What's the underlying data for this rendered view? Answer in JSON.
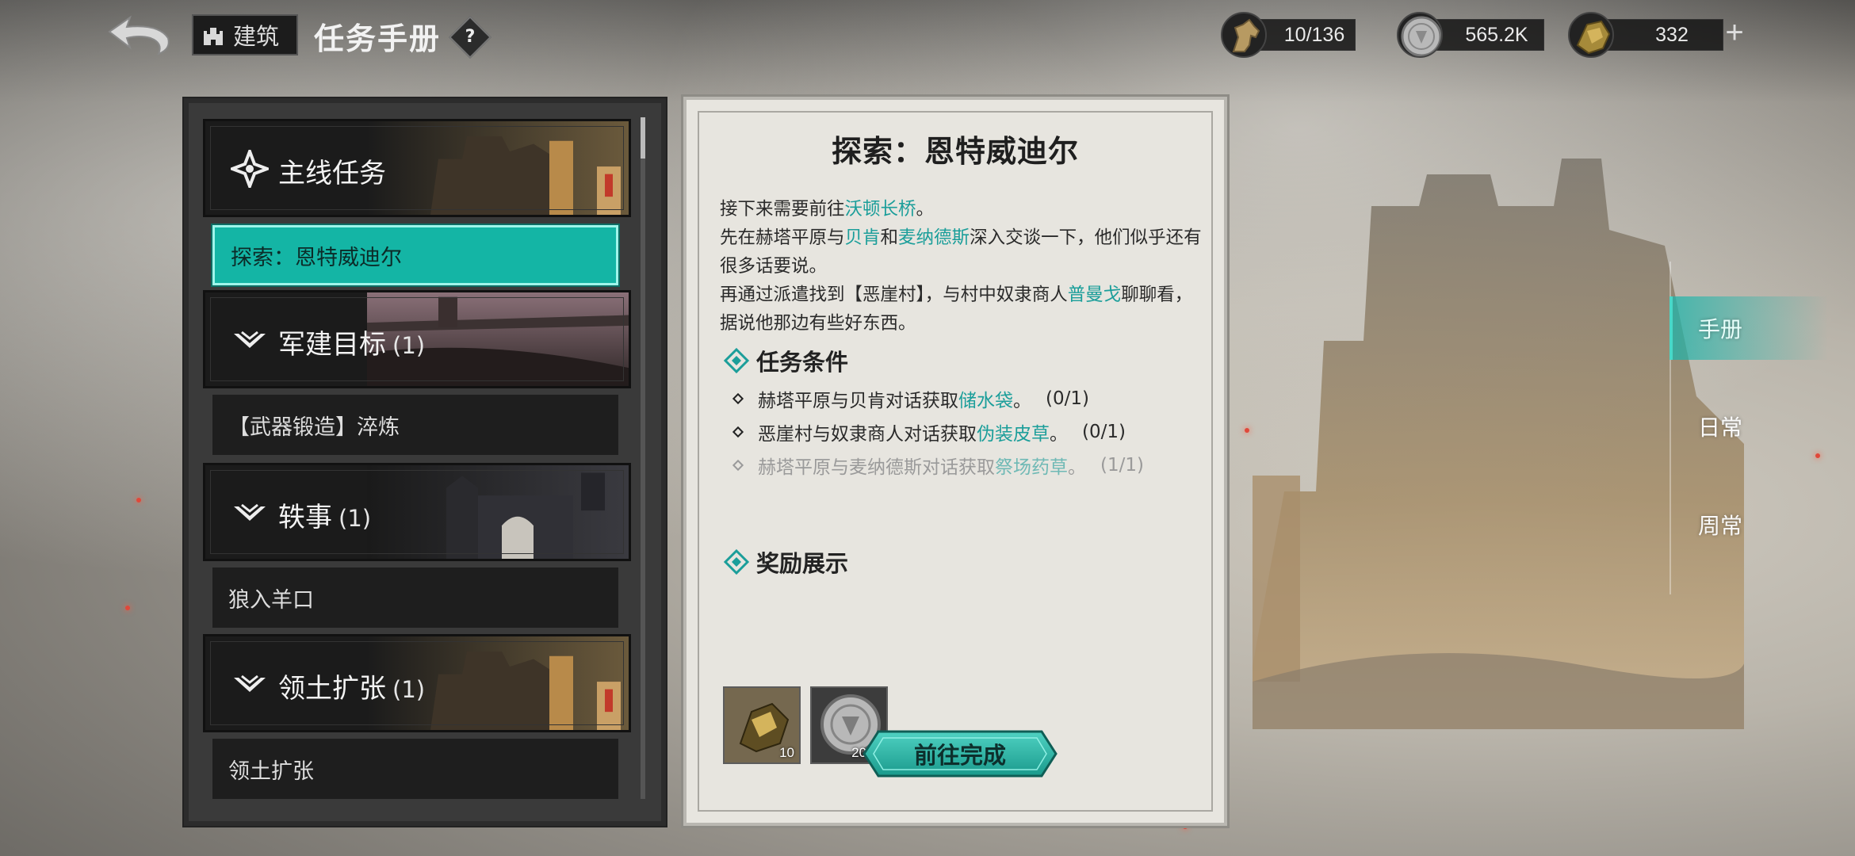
{
  "topbar": {
    "build_label": "建筑",
    "title": "任务手册",
    "help_label": "?"
  },
  "resources": {
    "stamina": "10/136",
    "silver": "565.2K",
    "gold": "332",
    "add_label": "+"
  },
  "categories": [
    {
      "label": "主线任务",
      "count": ""
    },
    {
      "label": "军建目标",
      "count": "(1)"
    },
    {
      "label": "轶事",
      "count": "(1)"
    },
    {
      "label": "领土扩张",
      "count": "(1)"
    }
  ],
  "tasks": {
    "main": "探索：恩特威迪尔",
    "military": "【武器锻造】淬炼",
    "anecdote": "狼入羊口",
    "territory": "领土扩张"
  },
  "detail": {
    "title": "探索：恩特威迪尔",
    "desc": {
      "l1a": "接下来需要前往",
      "l1b": "沃顿长桥",
      "l1c": "。",
      "l2a": "先在赫塔平原与",
      "l2b": "贝肯",
      "l2c": "和",
      "l2d": "麦纳德斯",
      "l2e": "深入交谈一下，他们似乎还有很多话要说。",
      "l3a": "再通过派遣找到【恶崖村】，与村中奴隶商人",
      "l3b": "普曼戈",
      "l3c": "聊聊看，据说他那边有些好东西。"
    },
    "conditions_title": "任务条件",
    "conditions": [
      {
        "pre": "赫塔平原与贝肯对话获取",
        "item": "储水袋",
        "post": "。",
        "progress": "(0/1)"
      },
      {
        "pre": "恶崖村与奴隶商人对话获取",
        "item": "伪装皮草",
        "post": "。",
        "progress": "(0/1)"
      },
      {
        "pre": "赫塔平原与麦纳德斯对话获取",
        "item": "祭场药草",
        "post": "。",
        "progress": "(1/1)"
      }
    ],
    "rewards_title": "奖励展示",
    "rewards": [
      {
        "icon": "gold-ore-icon",
        "qty": "10"
      },
      {
        "icon": "silver-coin-icon",
        "qty": "2000"
      }
    ],
    "go_button": "前往完成"
  },
  "tabs": [
    "手册",
    "日常",
    "周常"
  ],
  "colors": {
    "accent": "#14b5a5",
    "highlight_text": "#1b9e9a"
  }
}
